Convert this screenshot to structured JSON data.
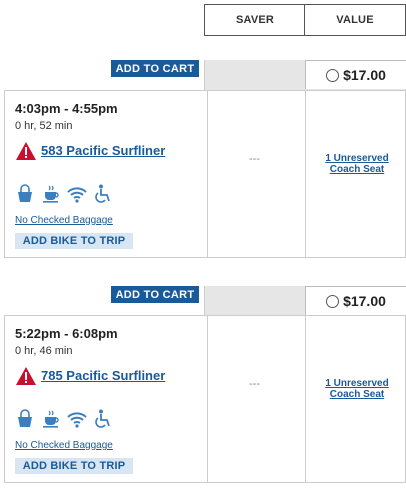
{
  "header": {
    "col_saver": "SAVER",
    "col_value": "VALUE"
  },
  "trips": [
    {
      "add_to_cart": "ADD TO CART",
      "price": "$17.00",
      "time": "4:03pm - 4:55pm",
      "duration": "0 hr, 52 min",
      "train": "583 Pacific Surfliner",
      "baggage": "No Checked Baggage",
      "bike": "ADD BIKE TO TRIP",
      "saver_value": "---",
      "value_line1": "1 Unreserved",
      "value_line2": "Coach Seat"
    },
    {
      "add_to_cart": "ADD TO CART",
      "price": "$17.00",
      "time": "5:22pm - 6:08pm",
      "duration": "0 hr, 46 min",
      "train": "785 Pacific Surfliner",
      "baggage": "No Checked Baggage",
      "bike": "ADD BIKE TO TRIP",
      "saver_value": "---",
      "value_line1": "1 Unreserved",
      "value_line2": "Coach Seat"
    }
  ],
  "icons": [
    "warning-icon",
    "bag-icon",
    "cafe-icon",
    "wifi-icon",
    "wheelchair-icon"
  ],
  "colors": {
    "accent": "#1a5a98",
    "bike_bg": "#d7e6f2",
    "warning": "#c8102e"
  }
}
